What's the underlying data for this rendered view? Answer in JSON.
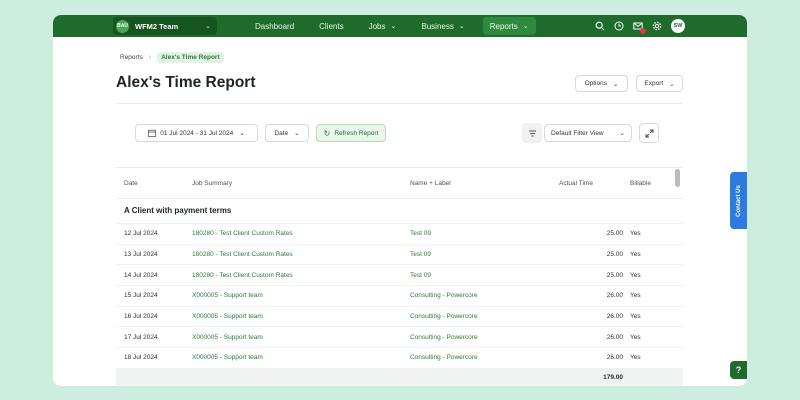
{
  "team": {
    "logo": "BAU",
    "name": "WFM2 Team"
  },
  "nav": {
    "items": [
      {
        "label": "Dashboard",
        "chevron": false
      },
      {
        "label": "Clients",
        "chevron": false
      },
      {
        "label": "Jobs",
        "chevron": true
      },
      {
        "label": "Business",
        "chevron": true
      },
      {
        "label": "Reports",
        "chevron": true,
        "active": true
      }
    ],
    "icons": [
      "search-icon",
      "clock-icon",
      "mail-icon",
      "settings-icon"
    ],
    "user_initials": "SW"
  },
  "breadcrumb": {
    "parent": "Reports",
    "current": "Alex's Time Report"
  },
  "page": {
    "title": "Alex's Time Report",
    "options_label": "Options",
    "export_label": "Export"
  },
  "filters": {
    "date_range": "01 Jul 2024 - 31 Jul 2024",
    "date_label": "Date",
    "refresh_label": "Refresh Report",
    "filter_view": "Default Filter View"
  },
  "table": {
    "headers": {
      "date": "Date",
      "job": "Job Summary",
      "name": "Name + Label",
      "time": "Actual Time",
      "billable": "Billable"
    },
    "group": "A Client with payment terms",
    "rows": [
      {
        "date": "12 Jul 2024",
        "job": "180280 - Test Client Custom Rates",
        "name": "Test 09",
        "time": "25.00",
        "billable": "Yes"
      },
      {
        "date": "13 Jul 2024",
        "job": "180280 - Test Client Custom Rates",
        "name": "Test 09",
        "time": "25.00",
        "billable": "Yes"
      },
      {
        "date": "14 Jul 2024",
        "job": "180280 - Test Client Custom Rates",
        "name": "Test 09",
        "time": "25.00",
        "billable": "Yes"
      },
      {
        "date": "15 Jul 2024",
        "job": "X000005 - Support team",
        "name": "Consulting - Powercore",
        "time": "26.00",
        "billable": "Yes"
      },
      {
        "date": "16 Jul 2024",
        "job": "X000005 - Support team",
        "name": "Consulting - Powercore",
        "time": "26.00",
        "billable": "Yes"
      },
      {
        "date": "17 Jul 2024",
        "job": "X000005 - Support team",
        "name": "Consulting - Powercore",
        "time": "26.00",
        "billable": "Yes"
      },
      {
        "date": "18 Jul 2024",
        "job": "X000005 - Support team",
        "name": "Consulting - Powercore",
        "time": "26.00",
        "billable": "Yes"
      }
    ],
    "total": "179.00"
  },
  "floating": {
    "contact_label": "Contact Us",
    "help_label": "?"
  }
}
